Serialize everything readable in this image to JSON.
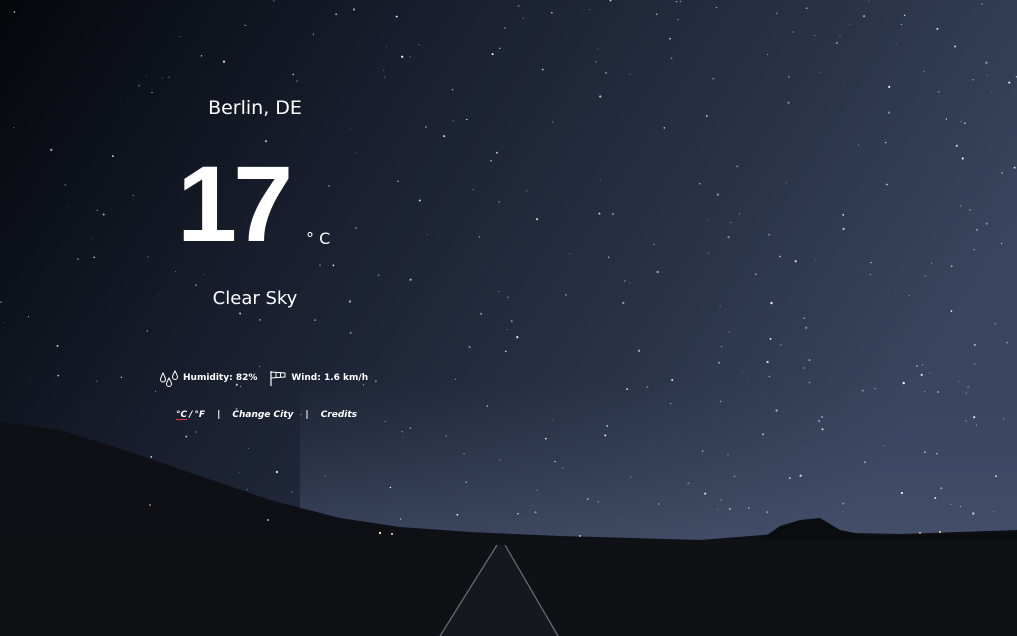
{
  "location": "Berlin, DE",
  "temperature": "17",
  "unit_symbol": "° C",
  "description": "Clear Sky",
  "humidity": {
    "icon": "humidity-drops-icon",
    "label": "Humidity: 82%"
  },
  "wind": {
    "icon": "wind-flag-icon",
    "label": "Wind: 1.6 km/h"
  },
  "links": {
    "celsius": "°C",
    "slash": "/",
    "fahrenheit": "°F",
    "separator": "|",
    "change_city": "Change City",
    "credits": "Credits"
  },
  "colors": {
    "accent": "#e0343b",
    "text": "#ffffff",
    "sky_dark": "#0b0e16",
    "sky_light": "#3a4560"
  }
}
